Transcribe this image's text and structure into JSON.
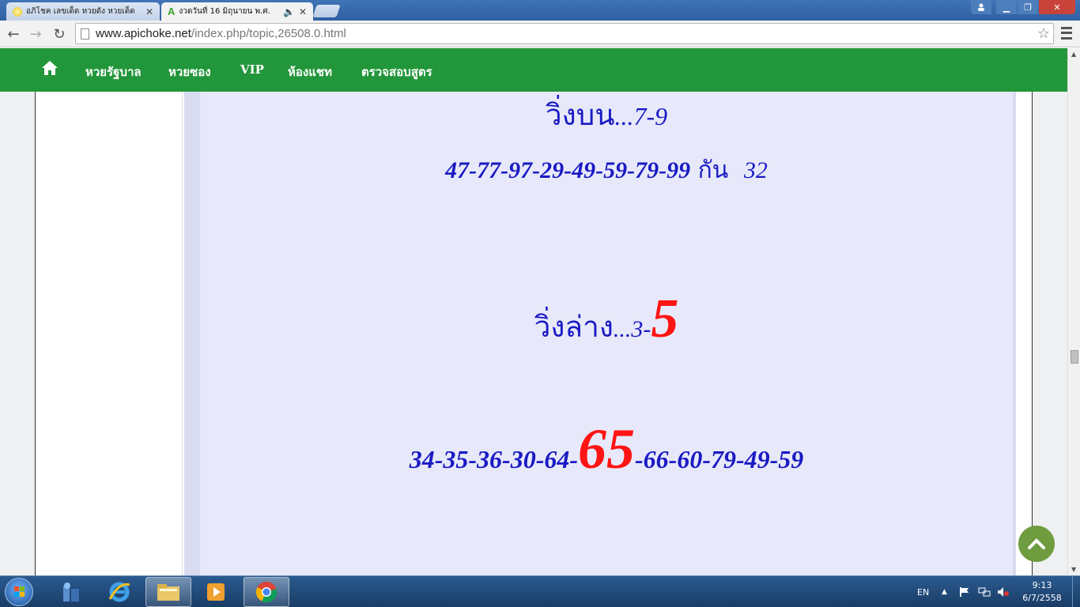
{
  "browser": {
    "tabs": [
      {
        "title": "อภิโชค เลขเด็ด หวยดัง หวยเด็ด",
        "active": false
      },
      {
        "title": "งวดวันที่ 16 มิถุนายน พ.ศ.",
        "active": true
      }
    ],
    "url_host": "www.apichoke.net",
    "url_path": "/index.php/topic,26508.0.html"
  },
  "site_nav": {
    "items": [
      "หวยรัฐบาล",
      "หวยซอง",
      "VIP",
      "ห้องแชท",
      "ตรวจสอบสูตร"
    ]
  },
  "post": {
    "line1_label": "วิ่งบน",
    "line1_value": "...7-9",
    "line2_numbers": "47-77-97-29-49-59-79-99",
    "line2_label": "กัน",
    "line2_extra": "32",
    "line3_label": "วิ่งล่าง",
    "line3_value": "...3-",
    "line3_highlight": "5",
    "line4_before": "34-35-36-30-64-",
    "line4_highlight": "65",
    "line4_after": "-66-60-79-49-59"
  },
  "taskbar": {
    "language": "EN",
    "time": "9:13",
    "date": "6/7/2558"
  },
  "colors": {
    "nav_green": "#22963a",
    "text_blue": "#1a1ac4",
    "highlight_red": "#ff1414",
    "post_bg": "#e7e9fa"
  }
}
